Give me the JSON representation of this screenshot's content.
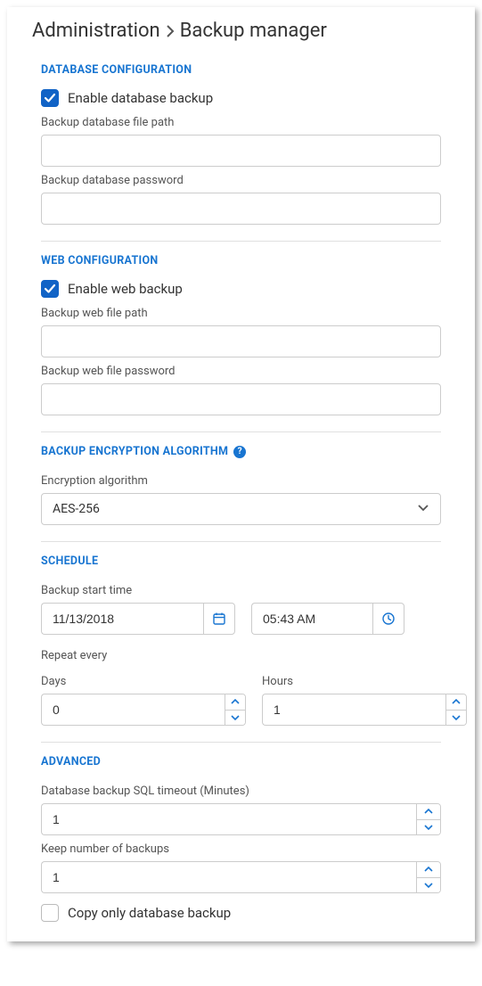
{
  "breadcrumb": {
    "parent": "Administration",
    "current": "Backup manager"
  },
  "sections": {
    "db": {
      "title": "DATABASE CONFIGURATION",
      "enable_label": "Enable database backup",
      "enable_checked": true,
      "path_label": "Backup database file path",
      "path_value": "",
      "password_label": "Backup database password",
      "password_value": ""
    },
    "web": {
      "title": "WEB CONFIGURATION",
      "enable_label": "Enable web backup",
      "enable_checked": true,
      "path_label": "Backup web file path",
      "path_value": "",
      "password_label": "Backup web file password",
      "password_value": ""
    },
    "encryption": {
      "title": "BACKUP ENCRYPTION ALGORITHM",
      "algo_label": "Encryption algorithm",
      "algo_value": "AES-256"
    },
    "schedule": {
      "title": "SCHEDULE",
      "start_label": "Backup start time",
      "date_value": "11/13/2018",
      "time_value": "05:43 AM",
      "repeat_label": "Repeat every",
      "days_label": "Days",
      "days_value": "0",
      "hours_label": "Hours",
      "hours_value": "1"
    },
    "advanced": {
      "title": "ADVANCED",
      "timeout_label": "Database backup SQL timeout (Minutes)",
      "timeout_value": "1",
      "keep_label": "Keep number of backups",
      "keep_value": "1",
      "copy_only_label": "Copy only database backup",
      "copy_only_checked": false
    }
  }
}
